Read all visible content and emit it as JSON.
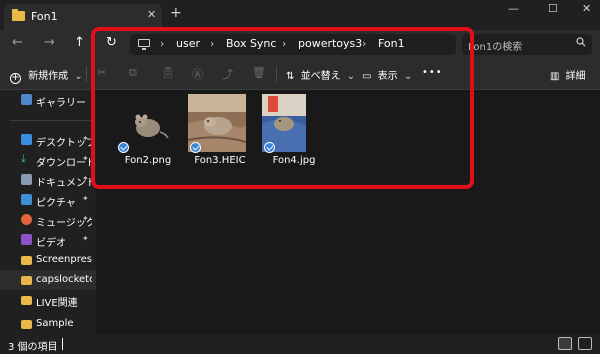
{
  "window": {
    "tab_title": "Fon1",
    "close_glyph": "✕",
    "new_tab_glyph": "+",
    "minimize_glyph": "—",
    "maximize_glyph": "☐",
    "close_window_glyph": "✕"
  },
  "nav": {
    "back": "←",
    "forward": "→",
    "up": "↑",
    "refresh": "↻"
  },
  "address": {
    "breadcrumbs": [
      "user",
      "Box Sync",
      "powertoys3",
      "Fon1"
    ],
    "separator": "›"
  },
  "search": {
    "placeholder": "Fon1の検索",
    "icon": "search-icon"
  },
  "toolbar": {
    "new_label": "新規作成",
    "new_chevron": "⌄",
    "sort_label": "並べ替え",
    "sort_chevron": "⌄",
    "view_label": "表示",
    "view_chevron": "⌄",
    "more": "•••",
    "details_label": "詳細"
  },
  "sidebar": {
    "items": [
      {
        "label": "ギャラリー",
        "icon": "gallery-icon",
        "pinned": false
      },
      {
        "label": "デスクトップ",
        "icon": "desktop-icon",
        "pinned": true
      },
      {
        "label": "ダウンロード",
        "icon": "download-icon",
        "pinned": true
      },
      {
        "label": "ドキュメント",
        "icon": "document-icon",
        "pinned": true
      },
      {
        "label": "ピクチャ",
        "icon": "pictures-icon",
        "pinned": true
      },
      {
        "label": "ミュージック",
        "icon": "music-icon",
        "pinned": true
      },
      {
        "label": "ビデオ",
        "icon": "video-icon",
        "pinned": true
      },
      {
        "label": "Screenpresso",
        "icon": "folder-icon",
        "pinned": false
      },
      {
        "label": "capslocketc",
        "icon": "folder-icon",
        "pinned": false
      },
      {
        "label": "LIVE関連",
        "icon": "folder-icon",
        "pinned": false
      },
      {
        "label": "Sample",
        "icon": "folder-icon",
        "pinned": false
      }
    ],
    "pin_glyph": "📌"
  },
  "files": [
    {
      "name": "Fon2.png",
      "synced": true
    },
    {
      "name": "Fon3.HEIC",
      "synced": true
    },
    {
      "name": "Fon4.jpg",
      "synced": true
    }
  ],
  "status": {
    "item_count": "3 個の項目"
  },
  "colors": {
    "accent": "#3b82d8",
    "highlight": "#e0101a",
    "folder": "#e8b84a"
  }
}
